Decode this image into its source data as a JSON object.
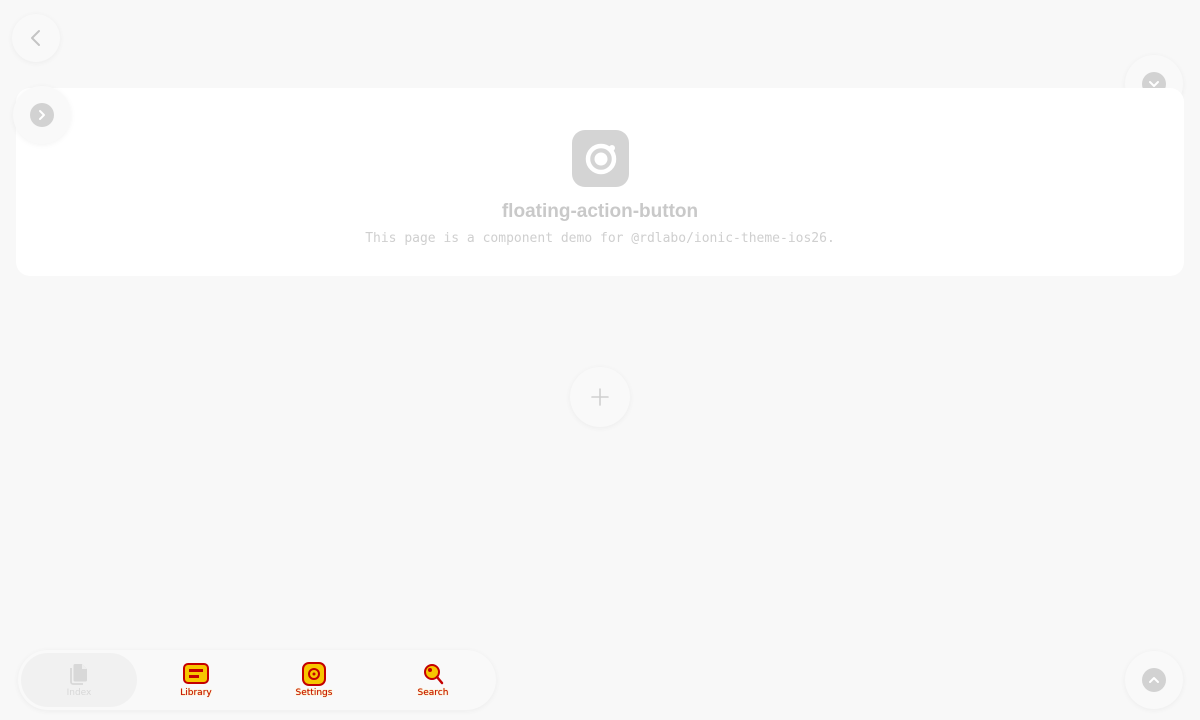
{
  "colors": {
    "background": "#f8f8f8",
    "card": "#ffffff",
    "muted_icon": "#d2d2d2",
    "muted_text": "#c9c9c9",
    "tab_glitch_red": "#c40000",
    "tab_glitch_yellow": "#f7c600"
  },
  "toolbar": {
    "back_icon": "chevron-back-icon"
  },
  "header": {
    "icon": "instagram-logo-icon",
    "title": "floating-action-button",
    "description": "This page is a component demo for @rdlabo/ionic-theme-ios26."
  },
  "fabs": {
    "top_right_icon": "chevron-down-circle-icon",
    "top_left_icon": "chevron-forward-circle-icon",
    "center_icon": "add-icon",
    "bottom_right_icon": "chevron-up-circle-icon"
  },
  "tabs": [
    {
      "label": "Index",
      "icon": "documents-icon",
      "selected": true
    },
    {
      "label": "Library",
      "icon": "library-icon",
      "selected": false
    },
    {
      "label": "Settings",
      "icon": "settings-icon",
      "selected": false
    },
    {
      "label": "Search",
      "icon": "search-icon",
      "selected": false
    }
  ]
}
